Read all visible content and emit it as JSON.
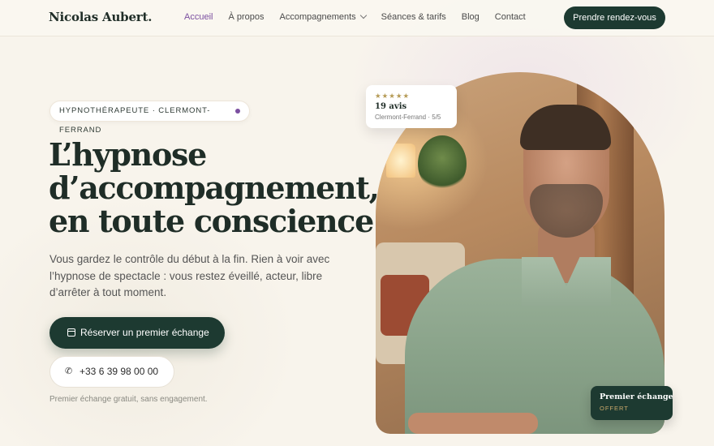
{
  "header": {
    "brand": "Nicolas Aubert.",
    "nav": [
      {
        "label": "Accueil",
        "active": true
      },
      {
        "label": "À propos",
        "active": false
      },
      {
        "label": "Accompagnements",
        "active": false,
        "dropdown": true
      },
      {
        "label": "Séances & tarifs",
        "active": false
      },
      {
        "label": "Blog",
        "active": false
      },
      {
        "label": "Contact",
        "active": false
      }
    ],
    "cta": "Prendre rendez-vous"
  },
  "hero": {
    "tag": "HYPNOTHÉRAPEUTE · CLERMONT-FERRAND",
    "headline": [
      "L’hypnose",
      "d’accompagnement,",
      "en toute conscience."
    ],
    "lead": "Vous gardez le contrôle du début à la fin. Rien à voir avec l’hypnose de spectacle : vous restez éveillé, acteur, libre d’arrêter à tout moment.",
    "primary_button": "Réserver un premier échange",
    "phone_button": "+33 6 39 98 00 00",
    "note": "Premier échange gratuit, sans engagement."
  },
  "review_card": {
    "stars": "★★★★★",
    "count": "19 avis",
    "meta": "Clermont-Ferrand · 5/5"
  },
  "offer_card": {
    "title": "Premier échange",
    "subtitle": "OFFERT"
  },
  "colors": {
    "accent": "#1d3a31",
    "nav_active": "#7b4fa0",
    "background": "#f8f4ec",
    "gold": "#c9a86a"
  },
  "icons": {
    "calendar": "calendar-icon",
    "phone": "phone-icon",
    "chevron": "chevron-down-icon"
  }
}
